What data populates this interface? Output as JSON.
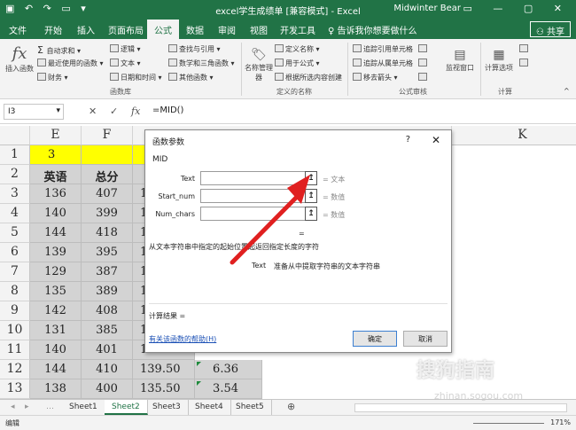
{
  "titlebar": {
    "title": "excel学生成绩单 [兼容模式] - Excel",
    "user": "Midwinter Bear"
  },
  "tabs": [
    "文件",
    "开始",
    "插入",
    "页面布局",
    "公式",
    "数据",
    "审阅",
    "视图",
    "开发工具"
  ],
  "active_tab": "公式",
  "tellme": "告诉我你想要做什么",
  "share": "共享",
  "ribbon": {
    "insert_function": "插入函数",
    "autosum": "自动求和",
    "recent": "最近使用的函数",
    "financial": "财务",
    "logical": "逻辑",
    "text": "文本",
    "datetime": "日期和时间",
    "lookup": "查找与引用",
    "math": "数学和三角函数",
    "more": "其他函数",
    "group_library": "函数库",
    "name_manager": "名称管理器",
    "define_name": "定义名称",
    "use_in_formula": "用于公式",
    "create_from_selection": "根据所选内容创建",
    "group_names": "定义的名称",
    "trace_precedents": "追踪引用单元格",
    "trace_dependents": "追踪从属单元格",
    "remove_arrows": "移去箭头",
    "watch_window": "监视窗口",
    "group_auditing": "公式审核",
    "calc_options": "计算选项",
    "group_calc": "计算"
  },
  "formula_bar": {
    "name_box": "I3",
    "formula": "=MID()"
  },
  "columns": [
    "E",
    "F",
    "K"
  ],
  "rows": [
    "1",
    "2",
    "3",
    "4",
    "5",
    "6",
    "7",
    "8",
    "9",
    "10",
    "11",
    "12",
    "13"
  ],
  "cells": {
    "e1": "3",
    "header_e": "英语",
    "header_f": "总分",
    "e_values": [
      "136",
      "140",
      "144",
      "139",
      "129",
      "135",
      "142",
      "131",
      "140",
      "144",
      "138"
    ],
    "f_values": [
      "407",
      "399",
      "418",
      "395",
      "387",
      "389",
      "408",
      "385",
      "401",
      "410",
      "400"
    ],
    "g_visible": [
      "1",
      "1",
      "1",
      "1",
      "1",
      "1",
      "1",
      "1",
      "1",
      "139.50",
      "135.50"
    ],
    "h_visible": [
      "6.36",
      "3.54"
    ]
  },
  "dialog": {
    "title": "函数参数",
    "help": "?",
    "close": "✕",
    "function_name": "MID",
    "args": [
      {
        "label": "Text",
        "result": "= 文本"
      },
      {
        "label": "Start_num",
        "result": "= 数值"
      },
      {
        "label": "Num_chars",
        "result": "= 数值"
      }
    ],
    "collapse_glyph": "↥",
    "equals": "=",
    "description": "从文本字符串中指定的起始位置起返回指定长度的字符",
    "arg_desc_name": "Text",
    "arg_desc": "准备从中提取字符串的文本字符串",
    "result_label": "计算结果 =",
    "help_link": "有关该函数的帮助(H)",
    "ok": "确定",
    "cancel": "取消"
  },
  "sheets": [
    "Sheet1",
    "Sheet2",
    "Sheet3",
    "Sheet4",
    "Sheet5"
  ],
  "active_sheet": "Sheet2",
  "status": {
    "mode": "编辑",
    "zoom": "171%"
  },
  "watermark": {
    "text": "搜狗指南",
    "url": "zhinan.sogou.com"
  },
  "colors": {
    "excel_green": "#217346",
    "highlight_yellow": "#ffff00",
    "selected_gray": "#d3d3d3",
    "arrow_red": "#e02020"
  }
}
